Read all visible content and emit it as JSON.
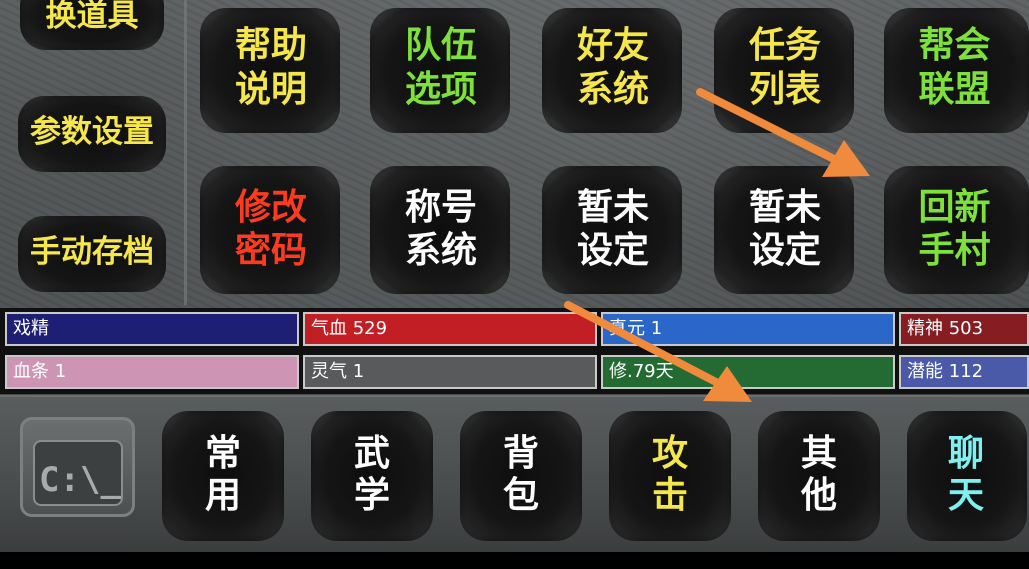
{
  "side_menu": [
    {
      "label": "换道具",
      "color": "#f4e64b"
    },
    {
      "label": "参数设置",
      "color": "#f4e64b"
    },
    {
      "label": "手动存档",
      "color": "#f4e64b"
    }
  ],
  "grid": [
    [
      {
        "line1": "帮助",
        "line2": "说明",
        "color": "#f4e64b"
      },
      {
        "line1": "队伍",
        "line2": "选项",
        "color": "#7ee03a"
      },
      {
        "line1": "好友",
        "line2": "系统",
        "color": "#f4e64b"
      },
      {
        "line1": "任务",
        "line2": "列表",
        "color": "#f4e64b"
      },
      {
        "line1": "帮会",
        "line2": "联盟",
        "color": "#7ee03a"
      }
    ],
    [
      {
        "line1": "修改",
        "line2": "密码",
        "color": "#ff3b1f"
      },
      {
        "line1": "称号",
        "line2": "系统",
        "color": "#ffffff"
      },
      {
        "line1": "暂未",
        "line2": "设定",
        "color": "#ffffff"
      },
      {
        "line1": "暂未",
        "line2": "设定",
        "color": "#ffffff"
      },
      {
        "line1": "回新",
        "line2": "手村",
        "color": "#7ee03a"
      }
    ]
  ],
  "stats": [
    [
      {
        "text": "戏精",
        "bg": "#1c1f73"
      },
      {
        "text": "气血 529",
        "bg": "#c21f25"
      },
      {
        "text": "真元 1",
        "bg": "#2a67c8"
      },
      {
        "text": "精神 503",
        "bg": "#861d22"
      }
    ],
    [
      {
        "text": "血条 1",
        "bg": "#cd95b3"
      },
      {
        "text": "灵气 1",
        "bg": "#585a5b"
      },
      {
        "text": "修.79天",
        "bg": "#236b32"
      },
      {
        "text": "潜能 112",
        "bg": "#4a5aa8"
      }
    ]
  ],
  "console": {
    "icon": "command-prompt-icon",
    "text": "C:\\_"
  },
  "tabs": [
    {
      "line1": "常",
      "line2": "用",
      "color": "#ffffff"
    },
    {
      "line1": "武",
      "line2": "学",
      "color": "#ffffff"
    },
    {
      "line1": "背",
      "line2": "包",
      "color": "#ffffff"
    },
    {
      "line1": "攻",
      "line2": "击",
      "color": "#f4e64b"
    },
    {
      "line1": "其",
      "line2": "他",
      "color": "#ffffff"
    },
    {
      "line1": "聊",
      "line2": "天",
      "color": "#7ff0f0"
    }
  ],
  "annotation_color": "#f08a3c"
}
